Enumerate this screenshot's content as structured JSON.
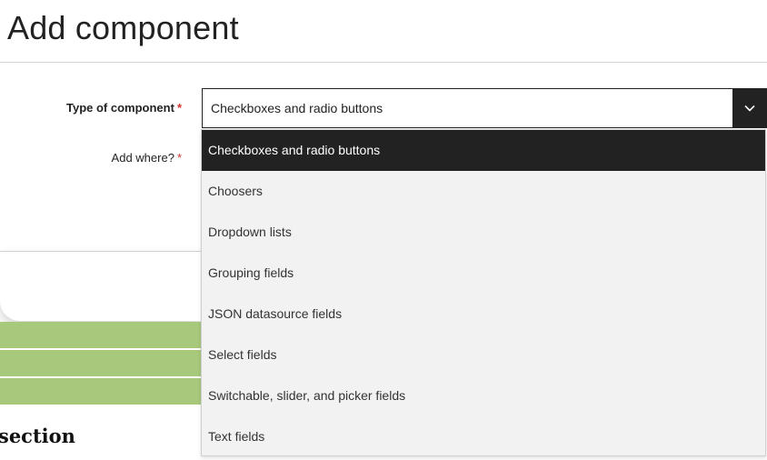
{
  "dialog": {
    "title": "Add component"
  },
  "form": {
    "type_label": "Type of component",
    "where_label": "Add where?",
    "required_mark": "*",
    "type_select": {
      "value": "Checkboxes and radio buttons",
      "options": [
        "Checkboxes and radio buttons",
        "Choosers",
        "Dropdown lists",
        "Grouping fields",
        "JSON datasource fields",
        "Select fields",
        "Switchable, slider, and picker fields",
        "Text fields"
      ],
      "highlighted_index": 0
    }
  },
  "background": {
    "section_heading": "section"
  },
  "icons": {
    "select_arrow": "chevron-down-icon"
  },
  "colors": {
    "accent_dark": "#222222",
    "required": "#d1332e",
    "band_green": "#a8c87c",
    "dropdown_bg": "#f2f2f2"
  }
}
